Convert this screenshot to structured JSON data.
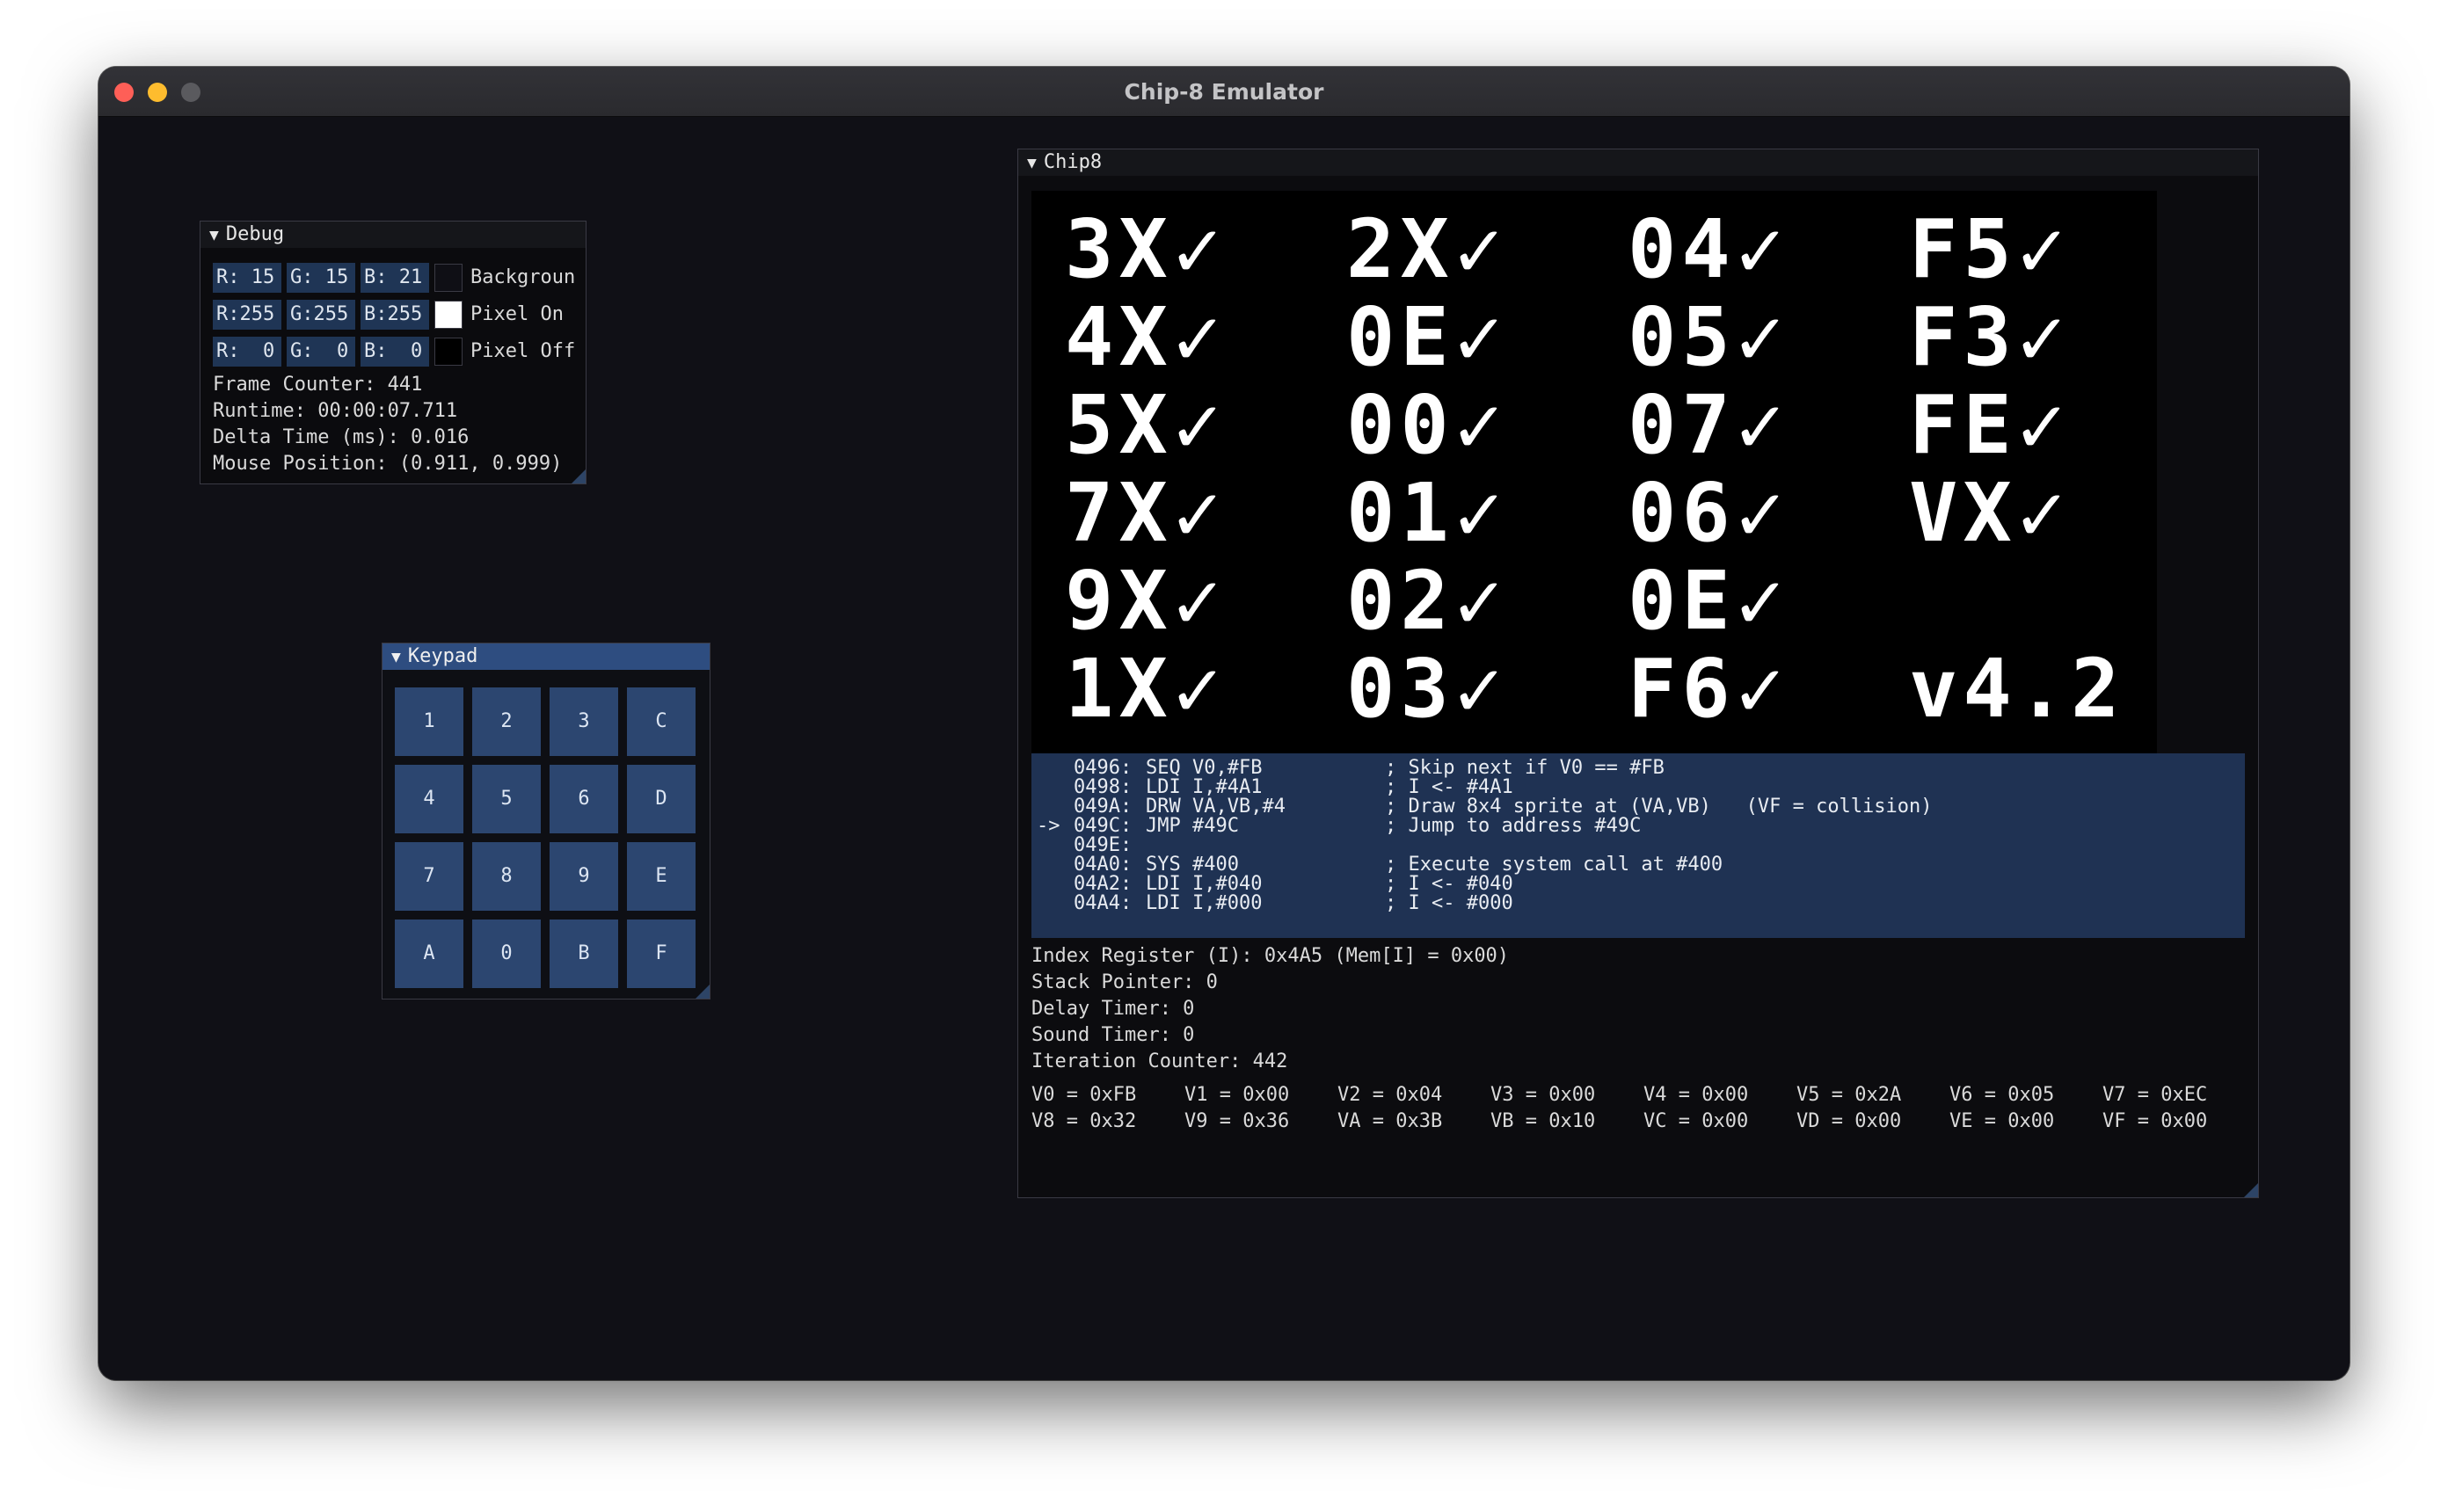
{
  "window": {
    "title": "Chip-8 Emulator"
  },
  "debug": {
    "title": "Debug",
    "colors": [
      {
        "r": "R: 15",
        "g": "G: 15",
        "b": "B: 21",
        "label": "Backgroun",
        "swatch": "#0f0f15"
      },
      {
        "r": "R:255",
        "g": "G:255",
        "b": "B:255",
        "label": "Pixel On",
        "swatch": "#ffffff"
      },
      {
        "r": "R:  0",
        "g": "G:  0",
        "b": "B:  0",
        "label": "Pixel Off",
        "swatch": "#000000"
      }
    ],
    "frame_counter": "Frame Counter: 441",
    "runtime": "Runtime: 00:00:07.711",
    "delta_time": "Delta Time (ms): 0.016",
    "mouse_position": "Mouse Position: (0.911, 0.999)"
  },
  "keypad": {
    "title": "Keypad",
    "keys": [
      "1",
      "2",
      "3",
      "C",
      "4",
      "5",
      "6",
      "D",
      "7",
      "8",
      "9",
      "E",
      "A",
      "0",
      "B",
      "F"
    ]
  },
  "chip8": {
    "title": "Chip8",
    "disassembly": [
      {
        "marker": "",
        "addr": "0496:",
        "instr": "SEQ V0,#FB",
        "comment": "; Skip next if V0 == #FB"
      },
      {
        "marker": "",
        "addr": "0498:",
        "instr": "LDI I,#4A1",
        "comment": "; I <- #4A1"
      },
      {
        "marker": "",
        "addr": "049A:",
        "instr": "DRW VA,VB,#4",
        "comment": "; Draw 8x4 sprite at (VA,VB)   (VF = collision)"
      },
      {
        "marker": "->",
        "addr": "049C:",
        "instr": "JMP #49C",
        "comment": "; Jump to address #49C"
      },
      {
        "marker": "",
        "addr": "049E:",
        "instr": "",
        "comment": ""
      },
      {
        "marker": "",
        "addr": "04A0:",
        "instr": "SYS #400",
        "comment": "; Execute system call at #400"
      },
      {
        "marker": "",
        "addr": "04A2:",
        "instr": "LDI I,#040",
        "comment": "; I <- #040"
      },
      {
        "marker": "",
        "addr": "04A4:",
        "instr": "LDI I,#000",
        "comment": "; I <- #000"
      }
    ],
    "index_register": "Index Register (I): 0x4A5 (Mem[I] = 0x00)",
    "stack_pointer": "Stack Pointer: 0",
    "delay_timer": "Delay Timer: 0",
    "sound_timer": "Sound Timer: 0",
    "iteration_counter": "Iteration Counter: 442",
    "registers": [
      "V0 = 0xFB",
      "V1 = 0x00",
      "V2 = 0x04",
      "V3 = 0x00",
      "V4 = 0x00",
      "V5 = 0x2A",
      "V6 = 0x05",
      "V7 = 0xEC",
      "V8 = 0x32",
      "V9 = 0x36",
      "VA = 0x3B",
      "VB = 0x10",
      "VC = 0x00",
      "VD = 0x00",
      "VE = 0x00",
      "VF = 0x00"
    ],
    "screen_lines": [
      [
        "3X✓",
        "2X✓",
        "04✓",
        "F5✓"
      ],
      [
        "4X✓",
        "0E✓",
        "05✓",
        "F3✓"
      ],
      [
        "5X✓",
        "00✓",
        "07✓",
        "FE✓"
      ],
      [
        "7X✓",
        "01✓",
        "06✓",
        "VX✓"
      ],
      [
        "9X✓",
        "02✓",
        "0E✓",
        ""
      ],
      [
        "1X✓",
        "03✓",
        "F6✓",
        "v4.2"
      ]
    ]
  }
}
